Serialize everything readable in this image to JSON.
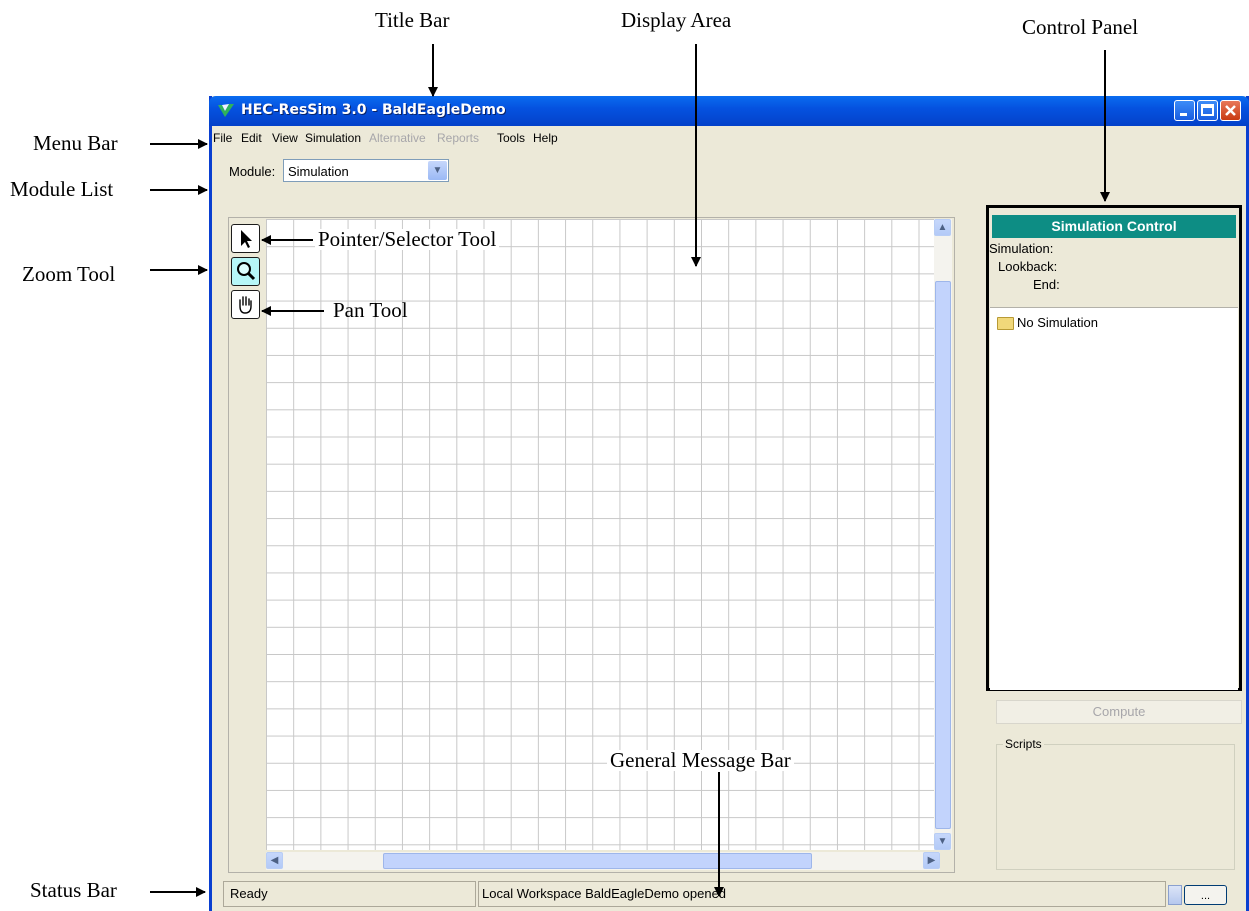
{
  "callouts": {
    "title_bar": "Title Bar",
    "display_area": "Display Area",
    "control_panel": "Control Panel",
    "menu_bar": "Menu Bar",
    "module_list": "Module List",
    "zoom_tool": "Zoom Tool",
    "pointer_tool": "Pointer/Selector Tool",
    "pan_tool": "Pan Tool",
    "general_message_bar": "General Message Bar",
    "status_bar": "Status Bar"
  },
  "window": {
    "title": "HEC-ResSim 3.0  - BaldEagleDemo",
    "buttons": [
      "minimize",
      "maximize",
      "close"
    ]
  },
  "menu": {
    "items": [
      {
        "label": "File",
        "enabled": true
      },
      {
        "label": "Edit",
        "enabled": true
      },
      {
        "label": "View",
        "enabled": true
      },
      {
        "label": "Simulation",
        "enabled": true
      },
      {
        "label": "Alternative",
        "enabled": false
      },
      {
        "label": "Reports",
        "enabled": false
      },
      {
        "label": "Tools",
        "enabled": true
      },
      {
        "label": "Help",
        "enabled": true
      }
    ]
  },
  "module": {
    "label": "Module:",
    "value": "Simulation"
  },
  "tools": {
    "pointer": "pointer-icon",
    "zoom": "magnifier-icon",
    "pan": "hand-icon"
  },
  "control_panel": {
    "header": "Simulation Control",
    "simulation_label": "Simulation:",
    "lookback_label": "Lookback:",
    "end_label": "End:",
    "tree_item": "No Simulation",
    "compute_label": "Compute",
    "scripts_label": "Scripts"
  },
  "status": {
    "state": "Ready",
    "message": "Local Workspace BaldEagleDemo opened",
    "more_label": "..."
  },
  "colors": {
    "titlebar": "#0552e0",
    "panel_header": "#0d8d84",
    "window_bg": "#ece9d8"
  }
}
